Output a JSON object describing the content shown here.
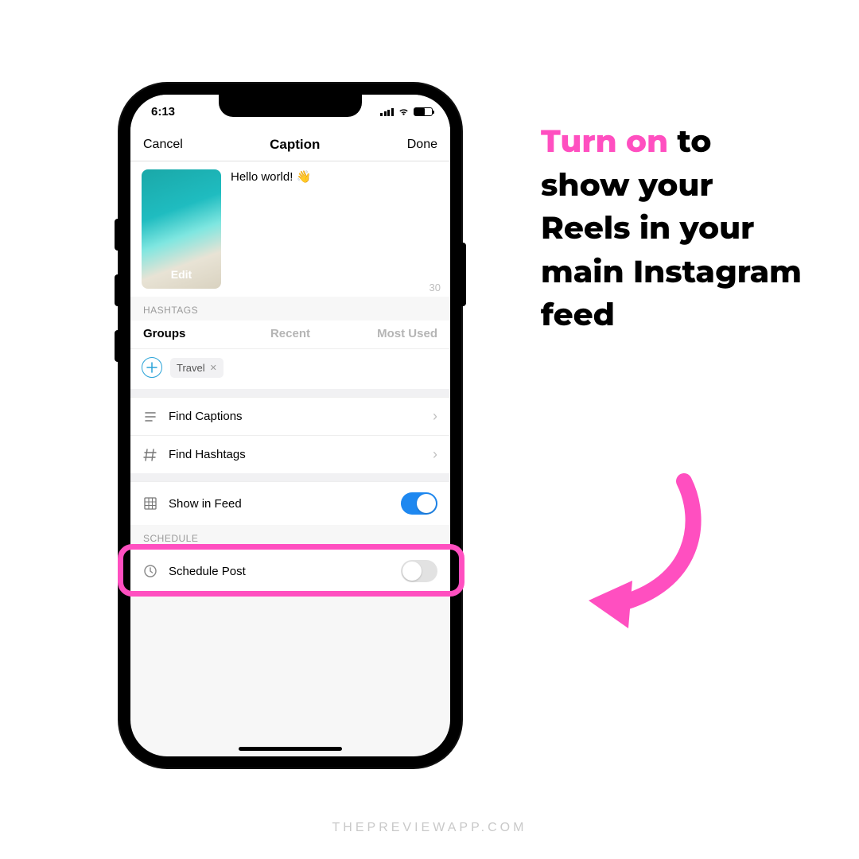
{
  "status": {
    "time": "6:13"
  },
  "nav": {
    "left": "Cancel",
    "title": "Caption",
    "right": "Done"
  },
  "caption": {
    "text": "Hello world! 👋",
    "thumb_label": "Edit",
    "char_count": "30"
  },
  "hashtags": {
    "header": "HASHTAGS",
    "tabs": {
      "groups": "Groups",
      "recent": "Recent",
      "most_used": "Most Used"
    },
    "chip": "Travel"
  },
  "rows": {
    "find_captions": "Find Captions",
    "find_hashtags": "Find Hashtags",
    "show_in_feed": "Show in Feed",
    "schedule_header": "SCHEDULE",
    "schedule_post": "Schedule Post"
  },
  "annotation": {
    "accent": "Turn on",
    "rest": " to show your Reels in your main Instagram feed"
  },
  "watermark": "THEPREVIEWAPP.COM",
  "colors": {
    "accent_pink": "#ff4fc0",
    "toggle_blue": "#1e88f0"
  }
}
